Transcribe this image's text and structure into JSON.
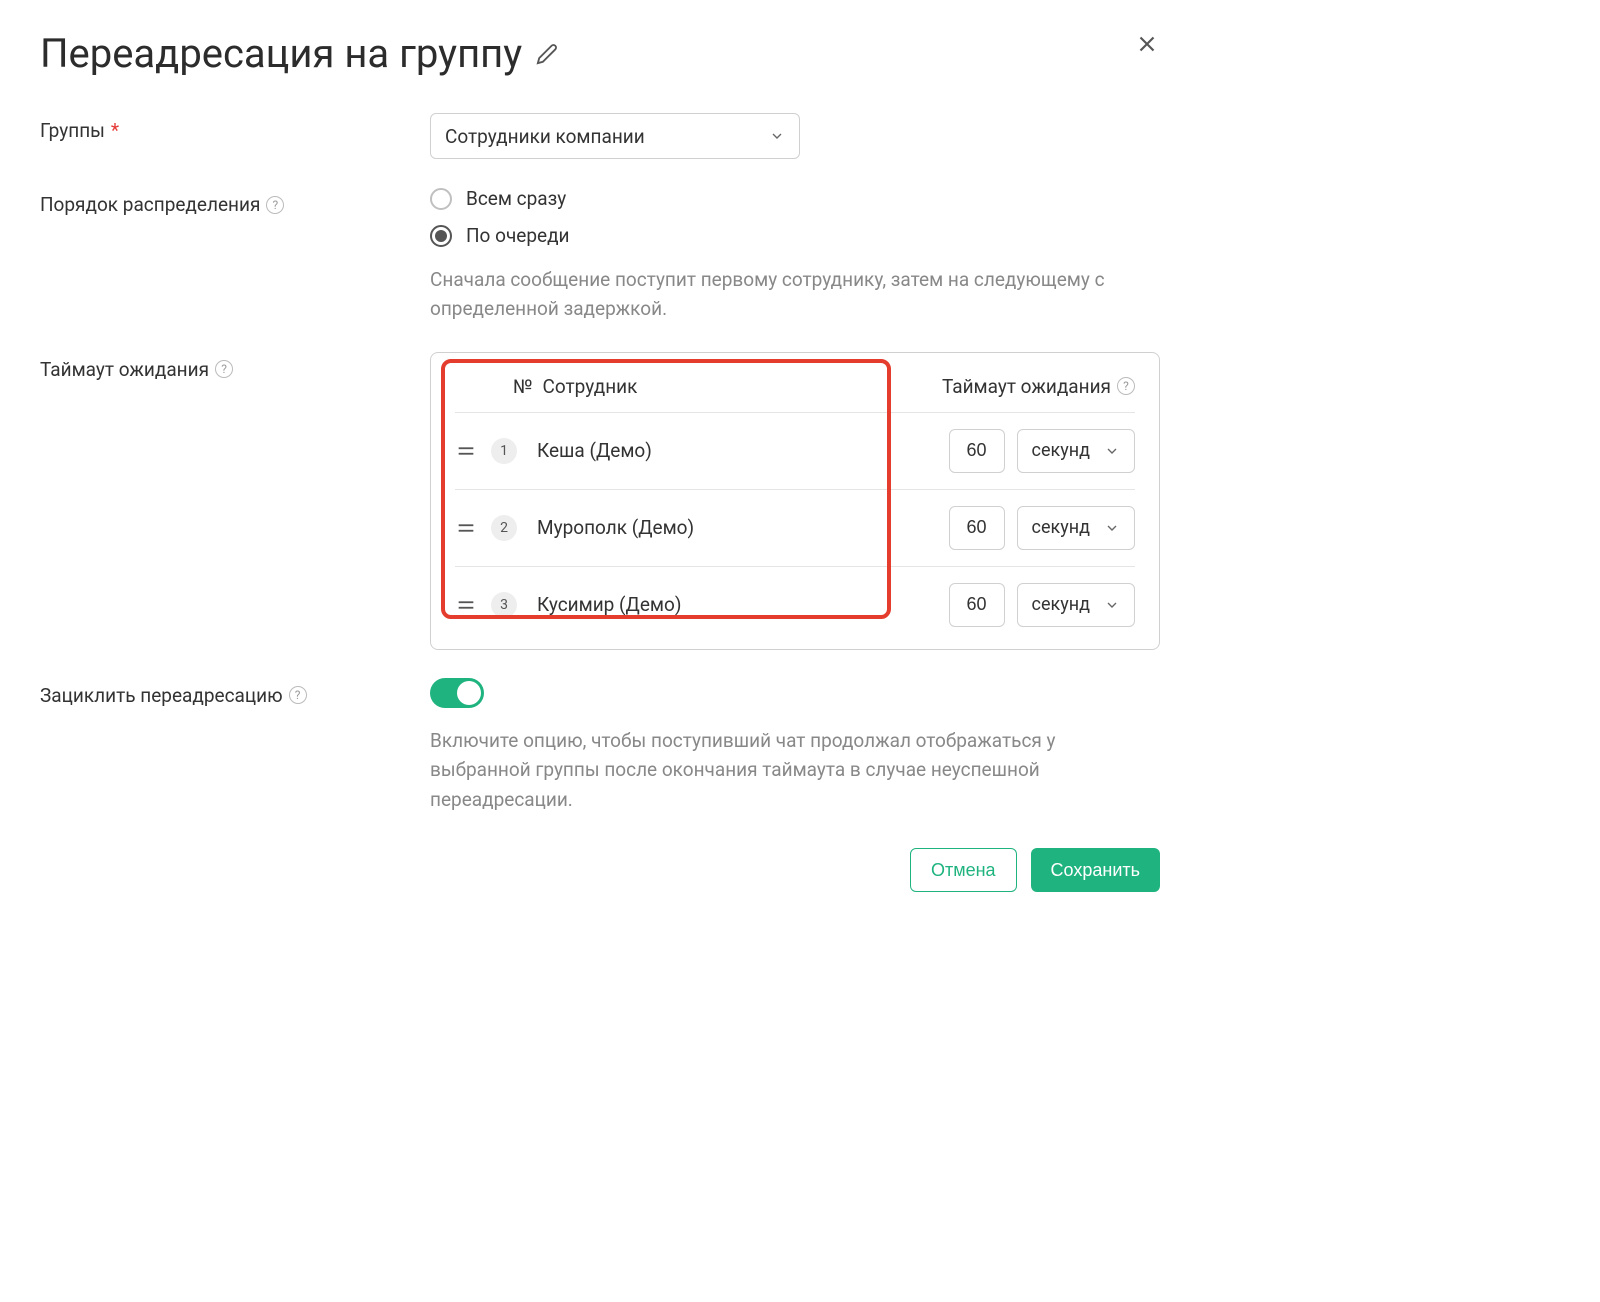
{
  "title": "Переадресация на группу",
  "labels": {
    "groups": "Группы",
    "distribution": "Порядок распределения",
    "timeout": "Таймаут ожидания",
    "loop": "Зациклить переадресацию"
  },
  "groups_select": "Сотрудники компании",
  "distribution": {
    "all": "Всем сразу",
    "queue": "По очереди",
    "description": "Сначала сообщение поступит первому сотруднику, затем на следующему с определенной задержкой."
  },
  "table": {
    "header_num": "№",
    "header_employee": "Сотрудник",
    "header_timeout": "Таймаут ожидания",
    "rows": [
      {
        "num": "1",
        "name": "Кеша (Демо)",
        "value": "60",
        "unit": "секунд"
      },
      {
        "num": "2",
        "name": "Мурополк (Демо)",
        "value": "60",
        "unit": "секунд"
      },
      {
        "num": "3",
        "name": "Кусимир (Демо)",
        "value": "60",
        "unit": "секунд"
      }
    ]
  },
  "loop_description": "Включите опцию, чтобы поступивший чат продолжал отображаться у выбранной группы после окончания таймаута в случае неуспешной переадресации.",
  "buttons": {
    "cancel": "Отмена",
    "save": "Сохранить"
  }
}
